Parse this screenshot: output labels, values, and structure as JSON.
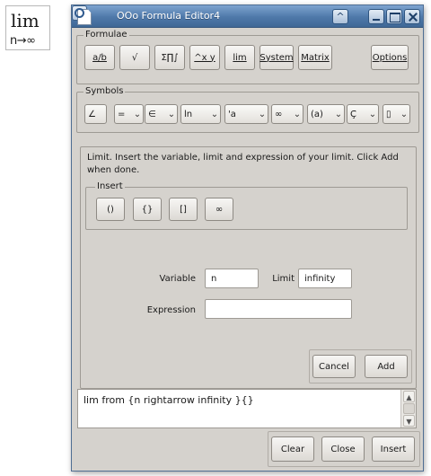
{
  "preview": {
    "lim": "lim",
    "sub": "n→∞"
  },
  "window": {
    "title": "OOo Formula Editor4"
  },
  "formulae": {
    "title": "Formulae",
    "buttons": [
      "a/b",
      "√",
      "Σ∏∫",
      "^x y",
      "lim",
      "System",
      "Matrix"
    ],
    "options": "Options"
  },
  "symbols": {
    "title": "Symbols",
    "dropdowns": [
      "∠",
      "=",
      "∈",
      "ln",
      "'a",
      "∞",
      "(a)",
      "Ç̃",
      "▯"
    ]
  },
  "panel": {
    "description": "Limit. Insert the variable, limit and expression of your limit. Click Add when done.",
    "insert_title": "Insert",
    "insert_buttons": [
      "()",
      "{}",
      "[]",
      "∞"
    ],
    "variable_label": "Variable",
    "variable_value": "n",
    "limit_label": "Limit",
    "limit_value": "infinity",
    "expression_label": "Expression",
    "expression_value": "",
    "cancel": "Cancel",
    "add": "Add"
  },
  "formula_text": "lim from {n rightarrow infinity }{}",
  "footer": {
    "clear": "Clear",
    "close": "Close",
    "insert": "Insert"
  },
  "colors": {
    "titlebar": "#4e78a9",
    "dialog_bg": "#d5d2cd"
  }
}
